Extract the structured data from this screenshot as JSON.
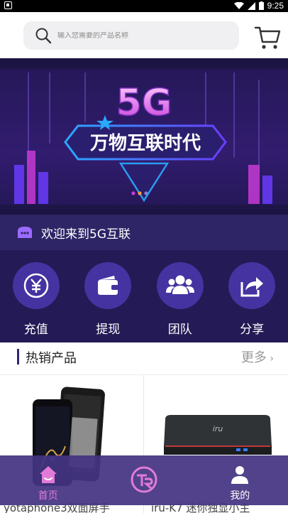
{
  "status_bar": {
    "time": "9:25"
  },
  "search": {
    "placeholder": "输入您需要的产品名称"
  },
  "banner": {
    "headline": "5G",
    "subtitle": "万物互联时代"
  },
  "welcome": {
    "text": "欢迎来到5G互联"
  },
  "actions": [
    {
      "label": "充值",
      "icon": "yuan-icon"
    },
    {
      "label": "提现",
      "icon": "wallet-icon"
    },
    {
      "label": "团队",
      "icon": "team-icon"
    },
    {
      "label": "分享",
      "icon": "share-icon"
    }
  ],
  "hot_products": {
    "title": "热销产品",
    "more": "更多",
    "items": [
      {
        "name": "yotaphone3双面屏手"
      },
      {
        "name": "iru-K7 迷你独显小主"
      }
    ]
  },
  "tabbar": {
    "items": [
      {
        "label": "首页",
        "icon": "home-icon",
        "active": true
      },
      {
        "label": "",
        "icon": "logo-icon",
        "active": false
      },
      {
        "label": "我的",
        "icon": "user-icon",
        "active": false
      }
    ]
  },
  "colors": {
    "accent": "#e27bd8",
    "primary_dark": "#241a55",
    "tab_bg": "#443482"
  }
}
